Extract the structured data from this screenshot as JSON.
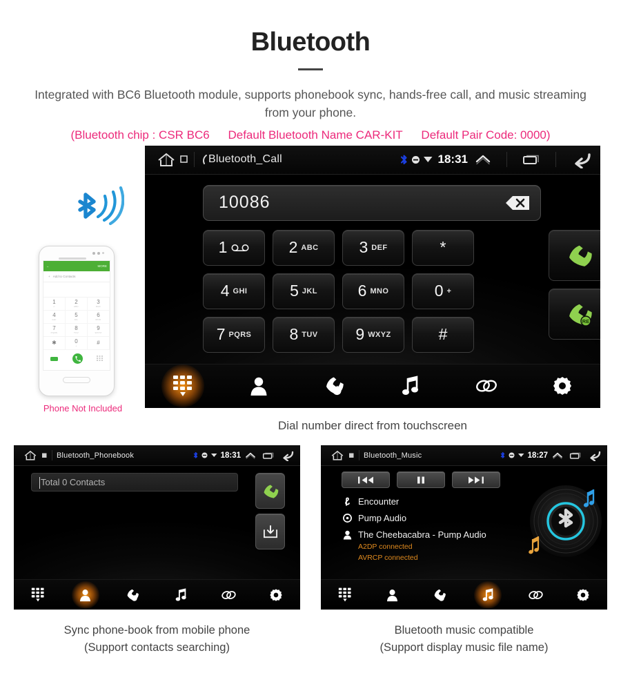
{
  "header": {
    "title": "Bluetooth",
    "intro": "Integrated with BC6 Bluetooth module, supports phonebook sync, hands-free call, and music streaming from your phone.",
    "spec_chip": "(Bluetooth chip : CSR BC6",
    "spec_name": "Default Bluetooth Name CAR-KIT",
    "spec_pair": "Default Pair Code: 0000)"
  },
  "colors": {
    "pink": "#ec2a7b",
    "accent_orange": "#ff9614",
    "bluetooth_blue": "#2196d8",
    "call_green": "#8fd14f",
    "status_orange": "#e08a1e",
    "ring_cyan": "#25c6e0"
  },
  "call_screen": {
    "status": {
      "title": "Bluetooth_Call",
      "clock": "18:31",
      "icons": [
        "home-icon",
        "sd-card-icon",
        "call-icon",
        "bluetooth-icon",
        "mute-icon",
        "signal-icon",
        "collapse-icon",
        "recents-icon",
        "back-icon"
      ]
    },
    "dial_value": "10086",
    "backspace_icon": "backspace-icon",
    "keys": [
      {
        "digit": "1",
        "sub": "",
        "icon": "voicemail-icon"
      },
      {
        "digit": "2",
        "sub": "ABC",
        "icon": ""
      },
      {
        "digit": "3",
        "sub": "DEF",
        "icon": ""
      },
      {
        "digit": "*",
        "sub": "",
        "icon": ""
      },
      {
        "digit": "4",
        "sub": "GHI",
        "icon": ""
      },
      {
        "digit": "5",
        "sub": "JKL",
        "icon": ""
      },
      {
        "digit": "6",
        "sub": "MNO",
        "icon": ""
      },
      {
        "digit": "0",
        "sub": "+",
        "icon": ""
      },
      {
        "digit": "7",
        "sub": "PQRS",
        "icon": ""
      },
      {
        "digit": "8",
        "sub": "TUV",
        "icon": ""
      },
      {
        "digit": "9",
        "sub": "WXYZ",
        "icon": ""
      },
      {
        "digit": "#",
        "sub": "",
        "icon": ""
      }
    ],
    "call_button_icon": "phone-call-icon",
    "redial_button_icon": "phone-redial-icon",
    "redial_badge": "RE",
    "nav": [
      {
        "icon": "dialpad-icon",
        "active": true
      },
      {
        "icon": "contacts-icon",
        "active": false
      },
      {
        "icon": "call-history-icon",
        "active": false
      },
      {
        "icon": "music-note-icon",
        "active": false
      },
      {
        "icon": "link-icon",
        "active": false
      },
      {
        "icon": "settings-gear-icon",
        "active": false
      }
    ],
    "caption": "Dial number direct from touchscreen"
  },
  "phone_illustration": {
    "bluetooth_wave_icon": "bluetooth-wave-icon",
    "screen_top_left": "back-arrow",
    "screen_top_right": "MORE",
    "add_contacts": "Add to Contacts",
    "keys": [
      {
        "d": "1",
        "s": "∞"
      },
      {
        "d": "2",
        "s": "ABC"
      },
      {
        "d": "3",
        "s": "DEF"
      },
      {
        "d": "4",
        "s": "GHI"
      },
      {
        "d": "5",
        "s": "JKL"
      },
      {
        "d": "6",
        "s": "MNO"
      },
      {
        "d": "7",
        "s": "PQRS"
      },
      {
        "d": "8",
        "s": "TUV"
      },
      {
        "d": "9",
        "s": "WXYZ"
      },
      {
        "d": "✱",
        "s": ""
      },
      {
        "d": "0",
        "s": "+"
      },
      {
        "d": "#",
        "s": ""
      }
    ],
    "caption": "Phone Not Included"
  },
  "phonebook_screen": {
    "status": {
      "title": "Bluetooth_Phonebook",
      "clock": "18:31"
    },
    "search_value": "Total 0 Contacts",
    "call_button_icon": "phone-call-icon",
    "download_button_icon": "download-contacts-icon",
    "nav": [
      {
        "icon": "dialpad-icon",
        "active": false
      },
      {
        "icon": "contacts-icon",
        "active": true
      },
      {
        "icon": "call-history-icon",
        "active": false
      },
      {
        "icon": "music-note-icon",
        "active": false
      },
      {
        "icon": "link-icon",
        "active": false
      },
      {
        "icon": "settings-gear-icon",
        "active": false
      }
    ],
    "caption_line1": "Sync phone-book from mobile phone",
    "caption_line2": "(Support contacts searching)"
  },
  "music_screen": {
    "status": {
      "title": "Bluetooth_Music",
      "clock": "18:27"
    },
    "transport": [
      {
        "icon": "previous-track-icon"
      },
      {
        "icon": "pause-icon"
      },
      {
        "icon": "next-track-icon"
      }
    ],
    "track": {
      "icon": "track-icon",
      "label": "Encounter"
    },
    "album": {
      "icon": "album-icon",
      "label": "Pump Audio"
    },
    "artist": {
      "icon": "artist-icon",
      "label": "The Cheebacabra - Pump Audio"
    },
    "status_lines": [
      "A2DP connected",
      "AVRCP connected"
    ],
    "album_art_icon": "vinyl-bluetooth-art",
    "nav": [
      {
        "icon": "dialpad-icon",
        "active": false
      },
      {
        "icon": "contacts-icon",
        "active": false
      },
      {
        "icon": "call-history-icon",
        "active": false
      },
      {
        "icon": "music-note-icon",
        "active": true
      },
      {
        "icon": "link-icon",
        "active": false
      },
      {
        "icon": "settings-gear-icon",
        "active": false
      }
    ],
    "caption_line1": "Bluetooth music compatible",
    "caption_line2": "(Support display music file name)"
  }
}
